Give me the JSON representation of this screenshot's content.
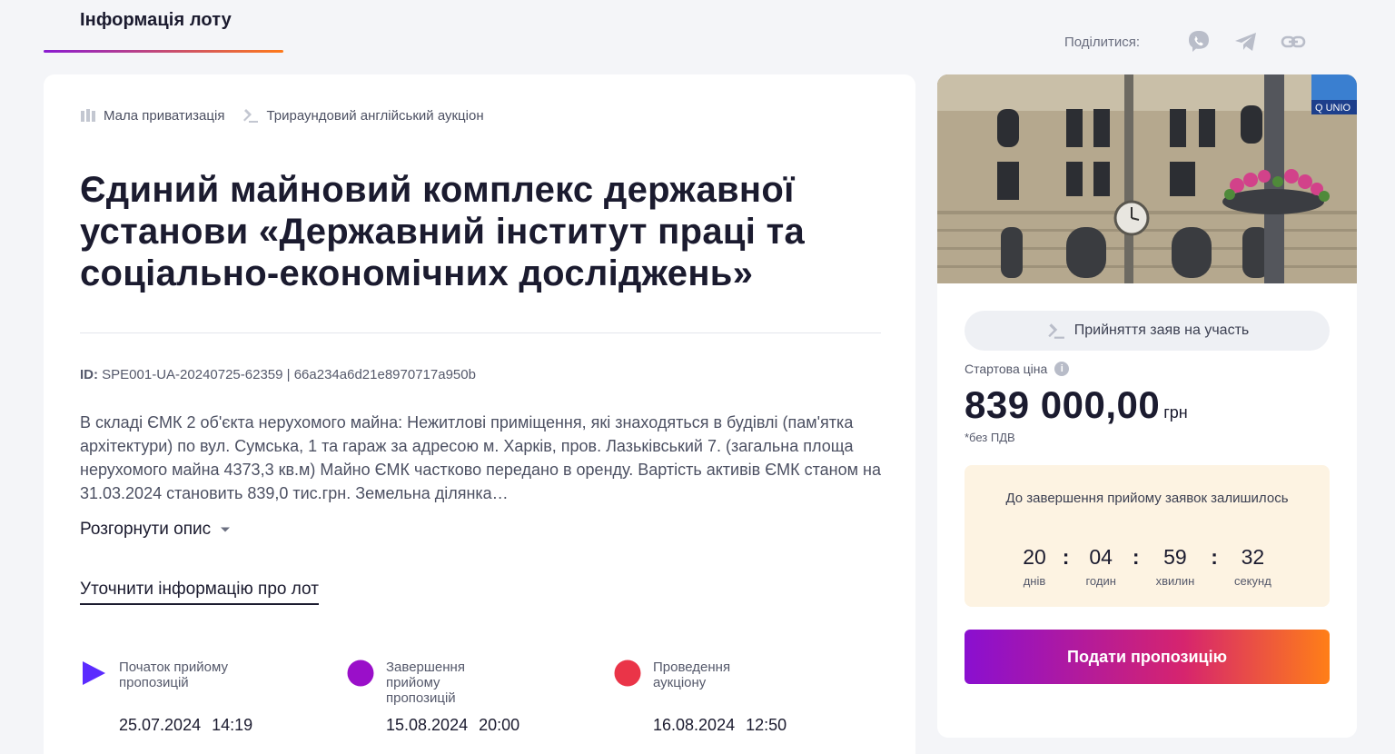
{
  "tab": {
    "label": "Інформація лоту"
  },
  "share": {
    "label": "Поділитися:",
    "icons": [
      "viber-icon",
      "telegram-icon",
      "link-icon"
    ]
  },
  "tags": [
    {
      "icon": "building-columns-icon",
      "label": "Мала приватизація"
    },
    {
      "icon": "gavel-icon",
      "label": "Трираундовий англійський аукціон"
    }
  ],
  "title": "Єдиний майновий комплекс державної установи «Державний інститут праці та соціально-економічних досліджень»",
  "lot_id": {
    "prefix": "ID:",
    "value": "SPE001-UA-20240725-62359 | 66a234a6d21e8970717a950b"
  },
  "description": "В складі ЄМК 2 об'єкта нерухомого майна: Нежитлові приміщення, які знаходяться в будівлі (пам'ятка архітектури) по вул. Сумська, 1 та гараж за адресою м. Харків, пров. Лазьківський 7. (загальна площа нерухомого майна 4373,3 кв.м) Майно ЄМК частково передано в оренду. Вартість активів ЄМК станом на 31.03.2024 становить 839,0 тис.грн. Земельна ділянка…",
  "expand_label": "Розгорнути опис",
  "clarify_label": "Уточнити інформацію про лот",
  "timeline": [
    {
      "label": "Початок прийому пропозицій",
      "date": "25.07.2024",
      "time": "14:19",
      "color": "#5b2bff",
      "marker": "play-icon"
    },
    {
      "label": "Завершення прийому пропозицій",
      "date": "15.08.2024",
      "time": "20:00",
      "color": "#9a0fc9",
      "marker": "circle-icon"
    },
    {
      "label": "Проведення аукціону",
      "date": "16.08.2024",
      "time": "12:50",
      "color": "#ea3448",
      "marker": "circle-icon"
    }
  ],
  "status": {
    "icon": "gavel-icon",
    "label": "Прийняття заяв на участь"
  },
  "price": {
    "label": "Стартова ціна",
    "value": "839 000,00",
    "currency": "грн",
    "vat_note": "*без ПДВ"
  },
  "countdown": {
    "title": "До завершення прийому заявок залишилось",
    "units": [
      {
        "value": "20",
        "caption": "днів"
      },
      {
        "value": "04",
        "caption": "годин"
      },
      {
        "value": "59",
        "caption": "хвилин"
      },
      {
        "value": "32",
        "caption": "секунд"
      }
    ]
  },
  "submit_label": "Подати пропозицію",
  "colors": {
    "accent_start": "#8a0fd0",
    "accent_end": "#ff7f17",
    "countdown_bg": "#fdf3e2"
  }
}
